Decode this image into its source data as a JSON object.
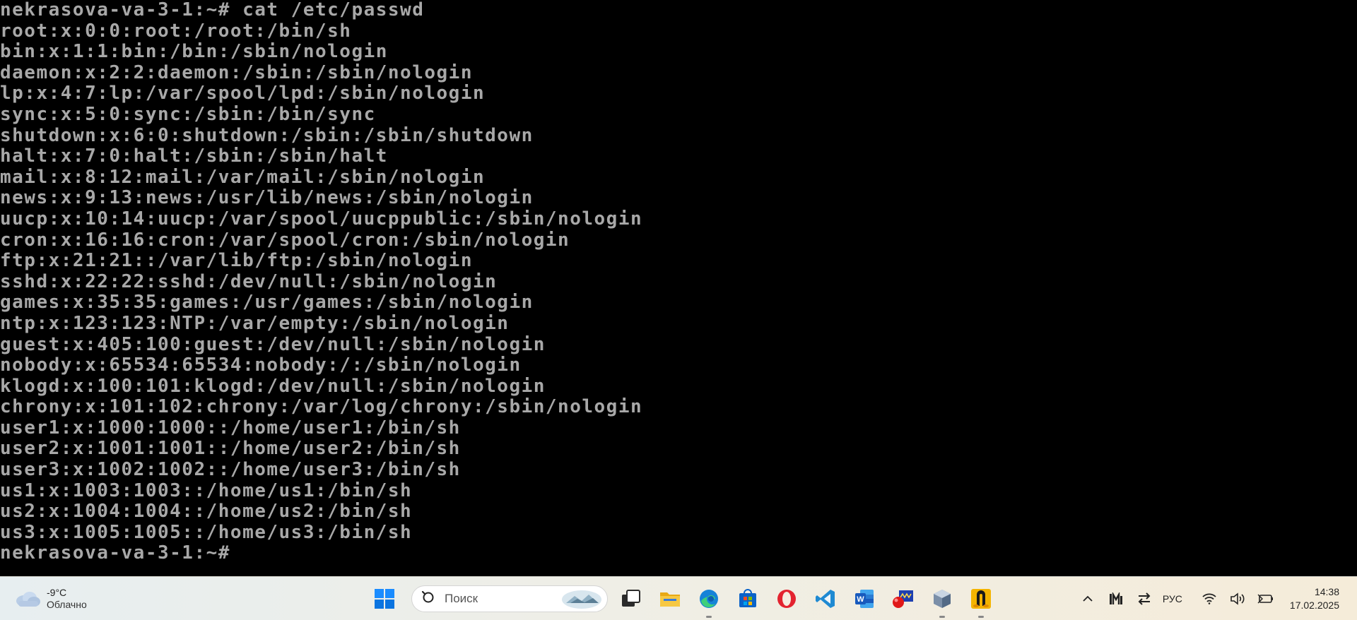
{
  "terminal": {
    "lines": [
      "nekrasova-va-3-1:~# cat /etc/passwd",
      "root:x:0:0:root:/root:/bin/sh",
      "bin:x:1:1:bin:/bin:/sbin/nologin",
      "daemon:x:2:2:daemon:/sbin:/sbin/nologin",
      "lp:x:4:7:lp:/var/spool/lpd:/sbin/nologin",
      "sync:x:5:0:sync:/sbin:/bin/sync",
      "shutdown:x:6:0:shutdown:/sbin:/sbin/shutdown",
      "halt:x:7:0:halt:/sbin:/sbin/halt",
      "mail:x:8:12:mail:/var/mail:/sbin/nologin",
      "news:x:9:13:news:/usr/lib/news:/sbin/nologin",
      "uucp:x:10:14:uucp:/var/spool/uucppublic:/sbin/nologin",
      "cron:x:16:16:cron:/var/spool/cron:/sbin/nologin",
      "ftp:x:21:21::/var/lib/ftp:/sbin/nologin",
      "sshd:x:22:22:sshd:/dev/null:/sbin/nologin",
      "games:x:35:35:games:/usr/games:/sbin/nologin",
      "ntp:x:123:123:NTP:/var/empty:/sbin/nologin",
      "guest:x:405:100:guest:/dev/null:/sbin/nologin",
      "nobody:x:65534:65534:nobody:/:/sbin/nologin",
      "klogd:x:100:101:klogd:/dev/null:/sbin/nologin",
      "chrony:x:101:102:chrony:/var/log/chrony:/sbin/nologin",
      "user1:x:1000:1000::/home/user1:/bin/sh",
      "user2:x:1001:1001::/home/user2:/bin/sh",
      "user3:x:1002:1002::/home/user3:/bin/sh",
      "us1:x:1003:1003::/home/us1:/bin/sh",
      "us2:x:1004:1004::/home/us2:/bin/sh",
      "us3:x:1005:1005::/home/us3:/bin/sh",
      "nekrasova-va-3-1:~#"
    ],
    "text_color": "#a8a8a8",
    "background": "#000000"
  },
  "taskbar": {
    "weather": {
      "temperature": "-9°C",
      "condition": "Облачно",
      "icon": "cloud-icon"
    },
    "search": {
      "placeholder": "Поиск",
      "icon": "search-icon"
    },
    "apps": [
      {
        "name": "start",
        "icon": "windows-start-icon"
      },
      {
        "name": "task-view",
        "icon": "task-view-icon"
      },
      {
        "name": "file-explorer",
        "icon": "folder-icon"
      },
      {
        "name": "edge",
        "icon": "edge-browser-icon",
        "running": true
      },
      {
        "name": "microsoft-store",
        "icon": "store-icon"
      },
      {
        "name": "opera",
        "icon": "opera-icon"
      },
      {
        "name": "vscode",
        "icon": "vscode-icon"
      },
      {
        "name": "word",
        "icon": "word-icon"
      },
      {
        "name": "app-red-blue",
        "icon": "generic-app-icon"
      },
      {
        "name": "virtualbox",
        "icon": "virtualbox-icon",
        "running": true
      },
      {
        "name": "virtual-machine",
        "icon": "linux-vm-icon",
        "running": true
      }
    ],
    "tray": {
      "language": "РУС",
      "time": "14:38",
      "date": "17.02.2025"
    },
    "accent_color": "#0078d4"
  }
}
